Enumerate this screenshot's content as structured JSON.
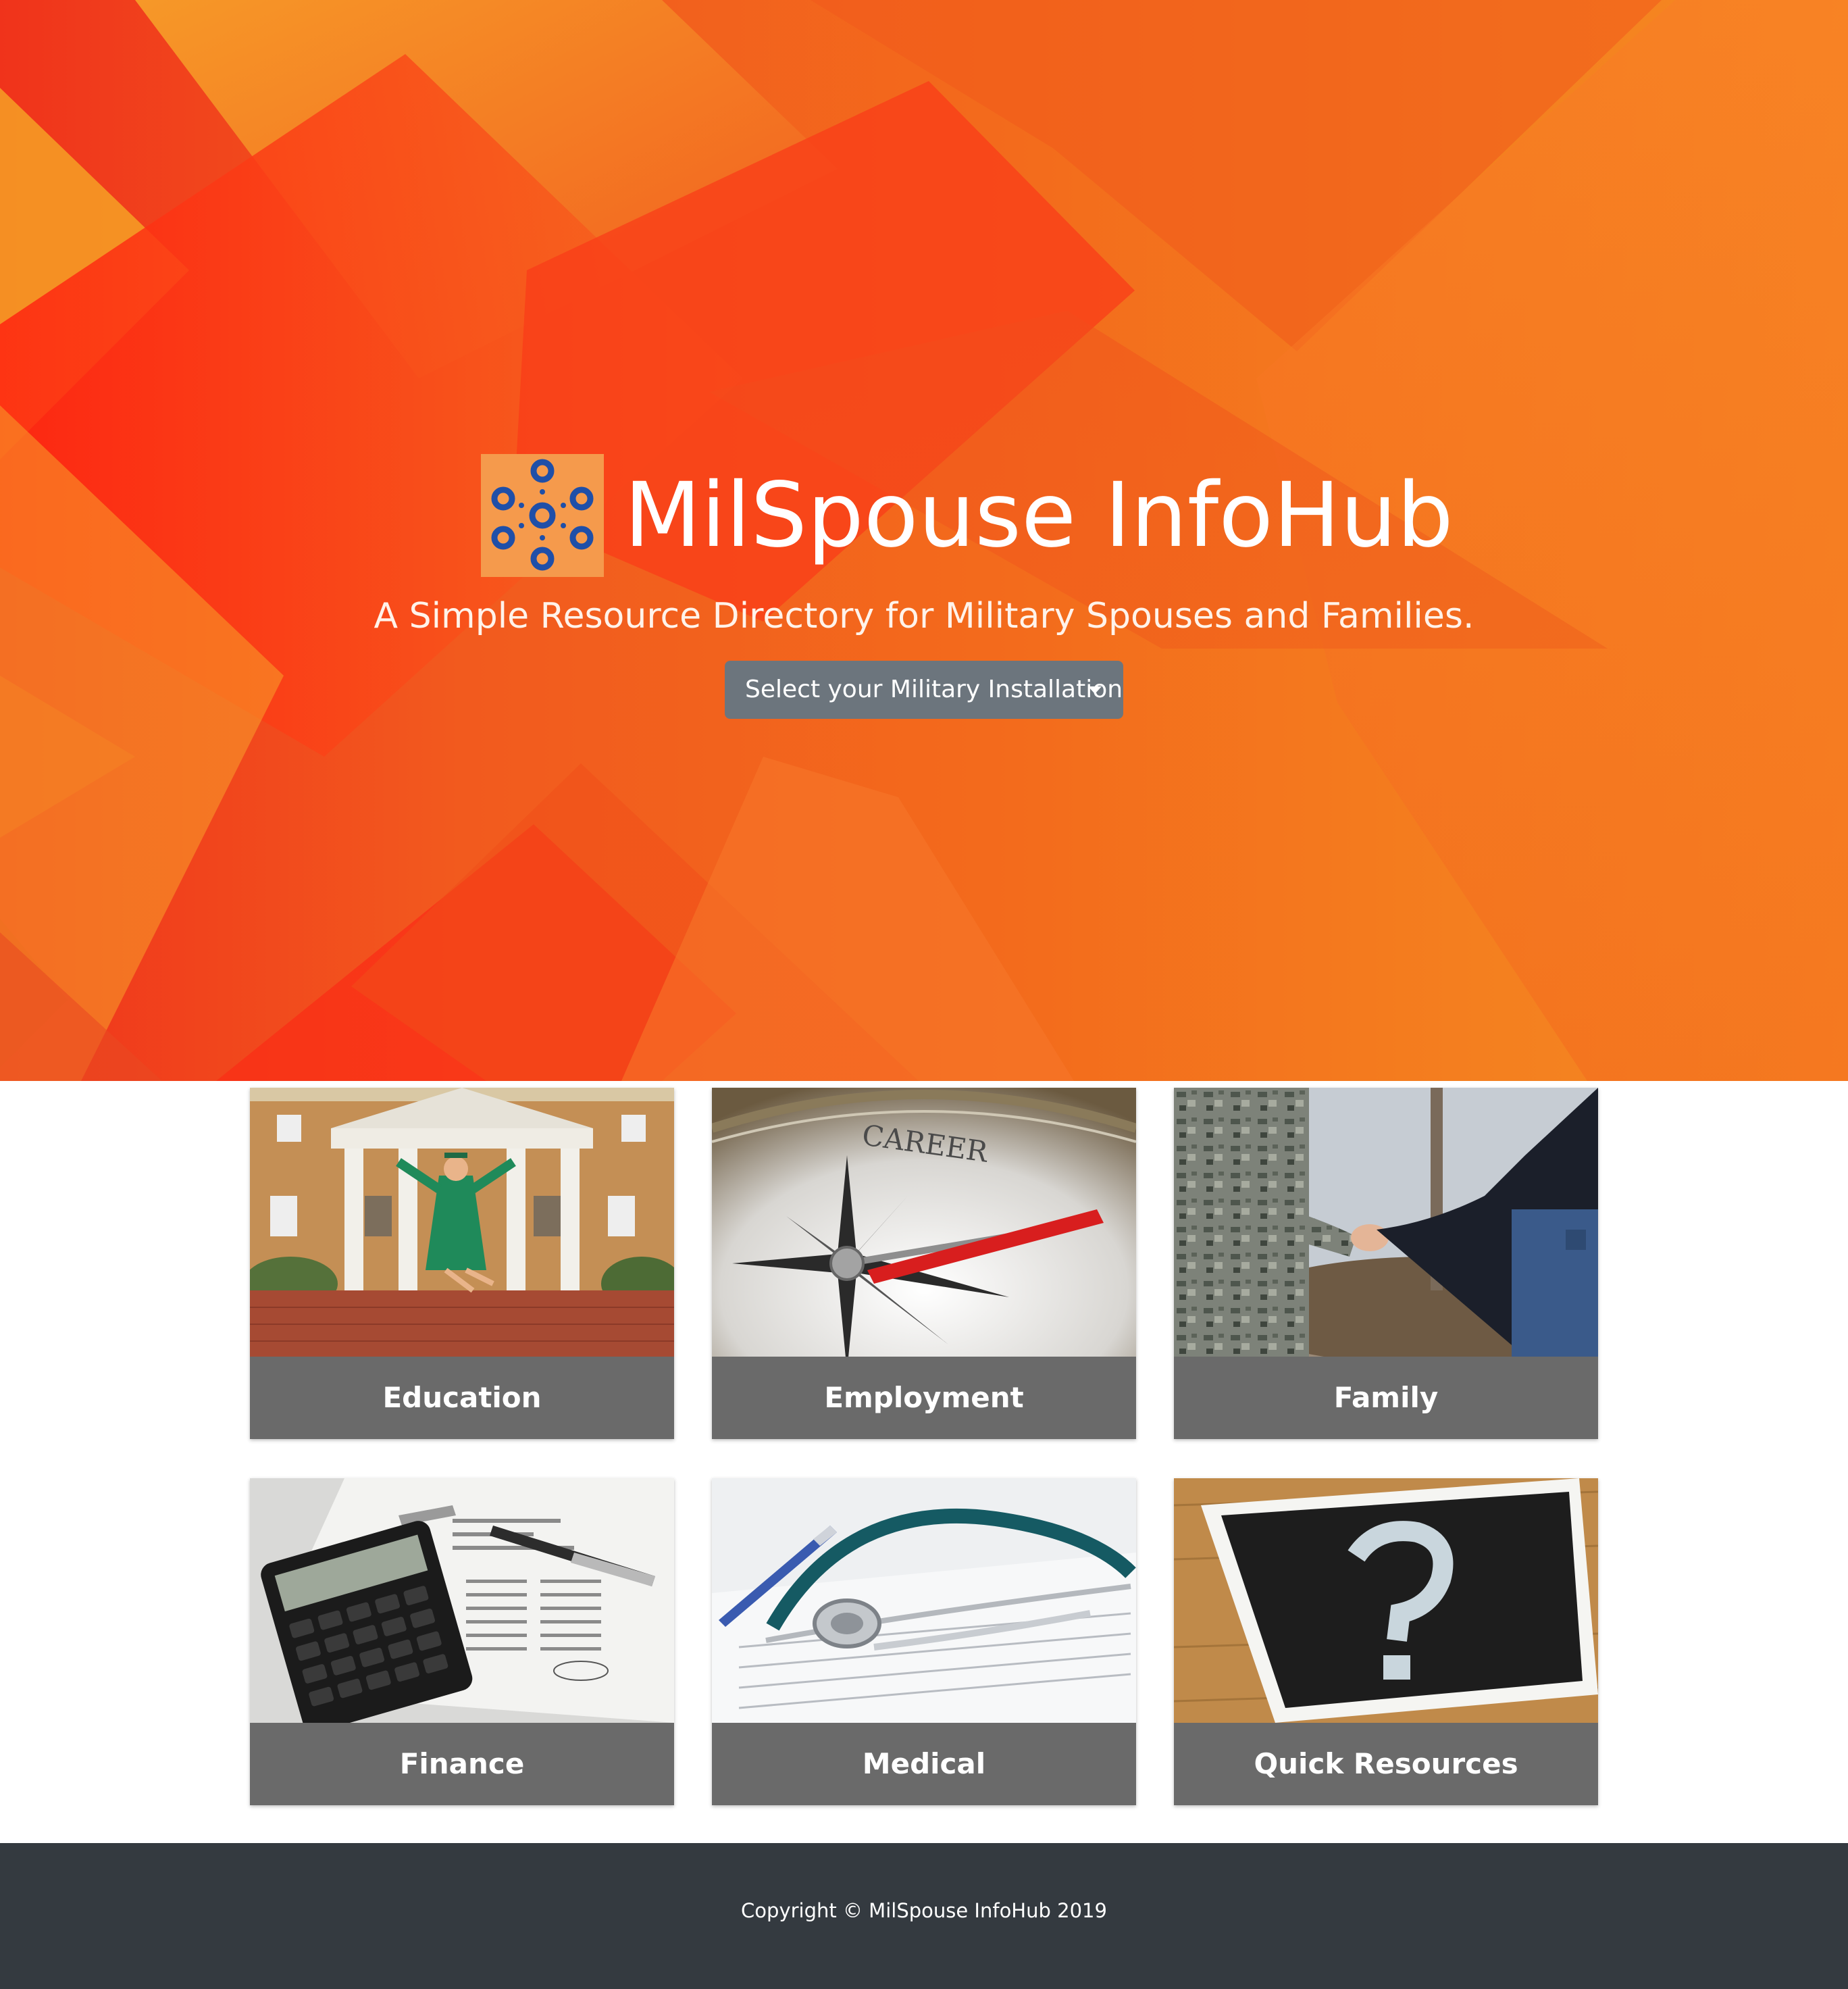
{
  "hero": {
    "title": "MilSpouse InfoHub",
    "tagline": "A Simple Resource Directory for Military Spouses and Families.",
    "install_dropdown_label": "Select your Military Installation",
    "logo_icon": "network-nodes-logo",
    "background_colors": [
      "#f0331b",
      "#f36b1c",
      "#f68a22"
    ]
  },
  "categories": [
    {
      "label": "Education",
      "icon": "graduate-jumping-photo"
    },
    {
      "label": "Employment",
      "icon": "career-compass-photo"
    },
    {
      "label": "Family",
      "icon": "couple-holding-hands-photo"
    },
    {
      "label": "Finance",
      "icon": "calculator-pen-photo"
    },
    {
      "label": "Medical",
      "icon": "stethoscope-photo"
    },
    {
      "label": "Quick Resources",
      "icon": "question-mark-chalkboard-photo"
    }
  ],
  "footer": {
    "copyright": "Copyright © MilSpouse InfoHub 2019"
  },
  "colors": {
    "card_label_bg": "#6a6a6a",
    "button_bg": "#6c757d",
    "footer_bg": "#343a40"
  }
}
